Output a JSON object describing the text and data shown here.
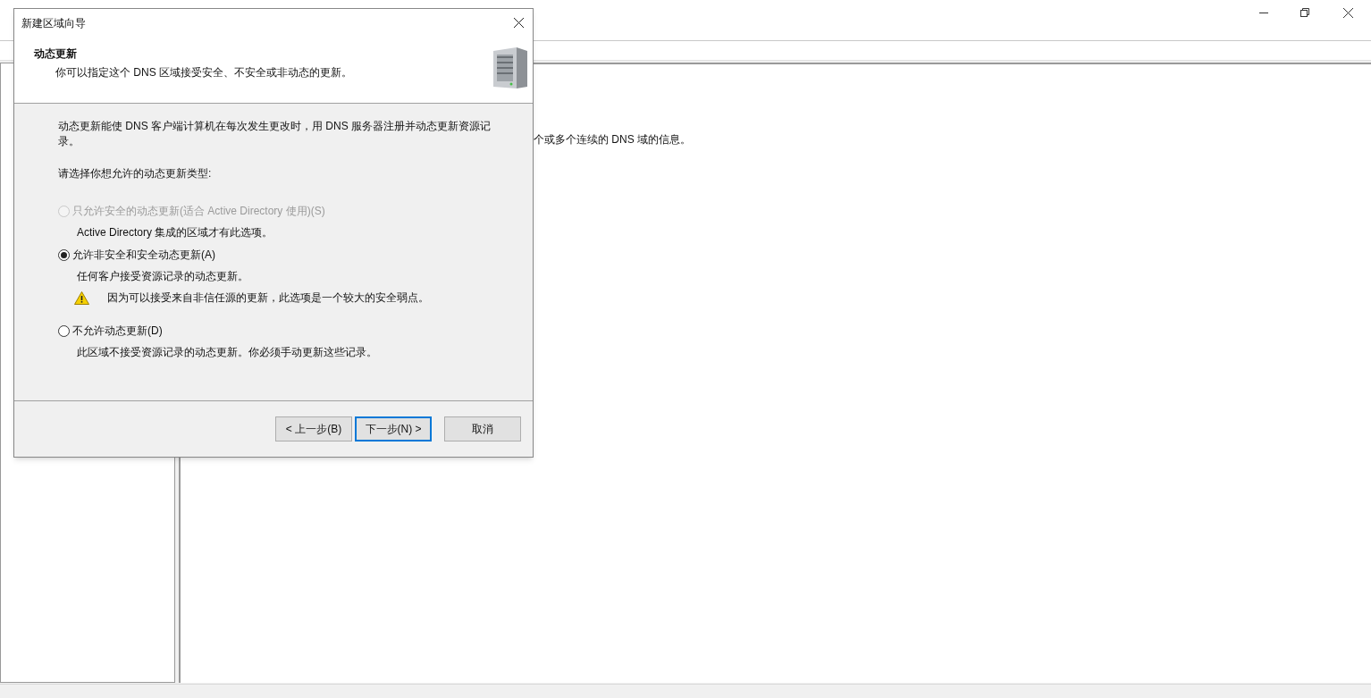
{
  "main_window": {
    "pane_text": "个或多个连续的 DNS 域的信息。"
  },
  "dialog": {
    "title": "新建区域向导",
    "header_title": "动态更新",
    "header_subtitle": "你可以指定这个 DNS 区域接受安全、不安全或非动态的更新。",
    "intro": "动态更新能使 DNS 客户端计算机在每次发生更改时，用 DNS 服务器注册并动态更新资源记录。",
    "prompt": "请选择你想允许的动态更新类型:",
    "options": [
      {
        "label": "只允许安全的动态更新(适合 Active Directory 使用)(S)",
        "description": "Active Directory 集成的区域才有此选项。",
        "selected": false,
        "disabled": true
      },
      {
        "label": "允许非安全和安全动态更新(A)",
        "description": "任何客户接受资源记录的动态更新。",
        "warning": "因为可以接受来自非信任源的更新，此选项是一个较大的安全弱点。",
        "selected": true,
        "disabled": false
      },
      {
        "label": "不允许动态更新(D)",
        "description": "此区域不接受资源记录的动态更新。你必须手动更新这些记录。",
        "selected": false,
        "disabled": false
      }
    ],
    "buttons": [
      {
        "label": "< 上一步(B)",
        "focused": false
      },
      {
        "label": "下一步(N) >",
        "focused": true
      },
      {
        "label": "取消",
        "focused": false
      }
    ]
  }
}
